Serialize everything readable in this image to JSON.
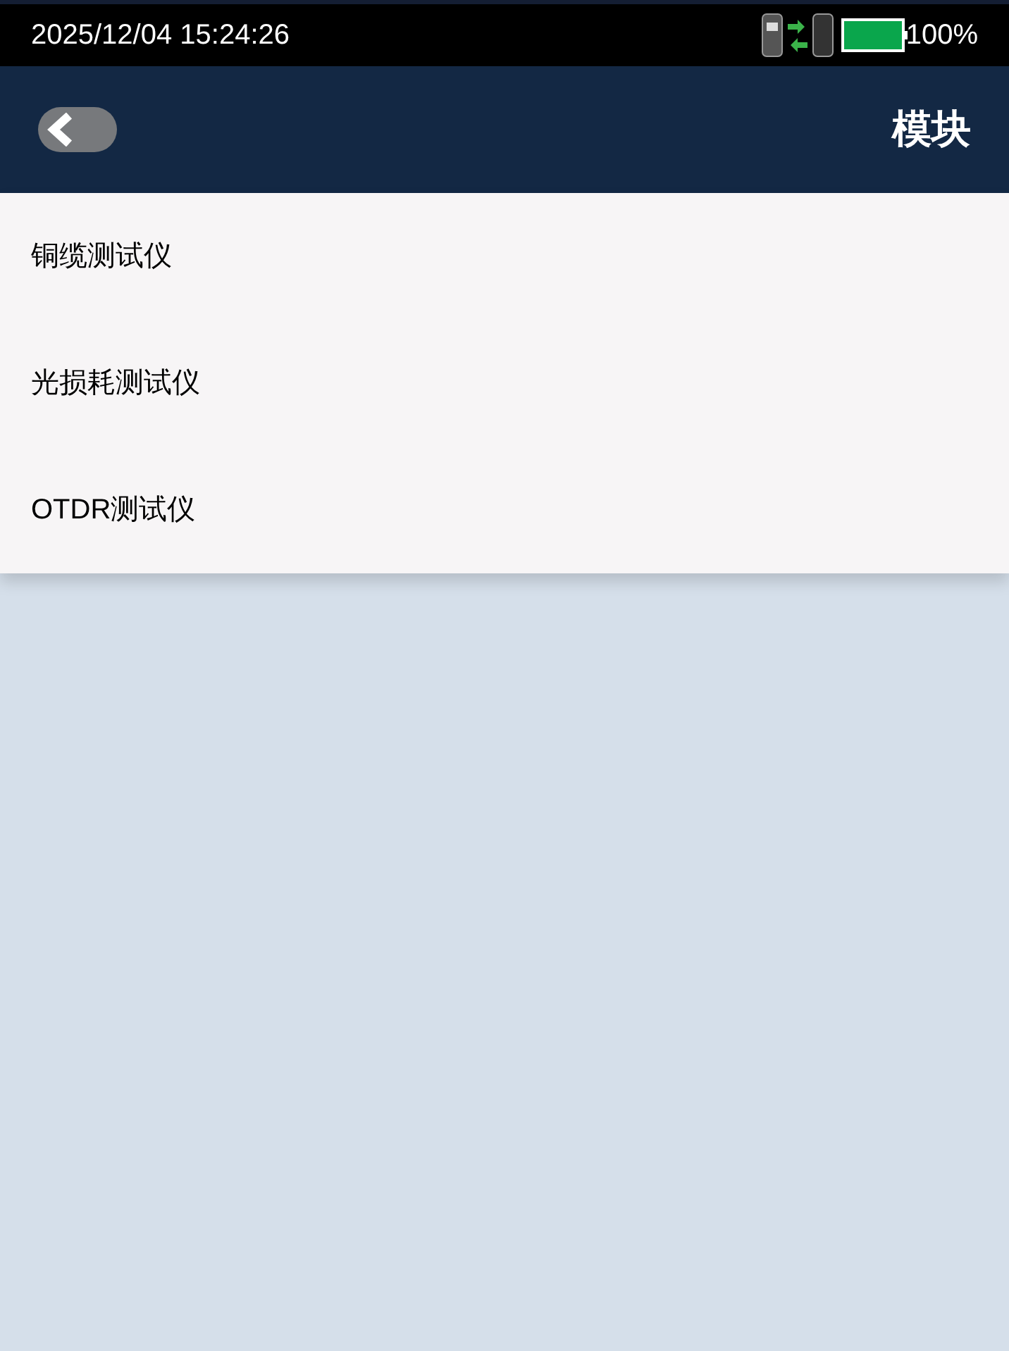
{
  "status_bar": {
    "time": "2025/12/04 15:24:26",
    "battery": "100%"
  },
  "header": {
    "title": "模块"
  },
  "menu": [
    {
      "label": "铜缆测试仪"
    },
    {
      "label": "光损耗测试仪"
    },
    {
      "label": "OTDR测试仪"
    }
  ]
}
